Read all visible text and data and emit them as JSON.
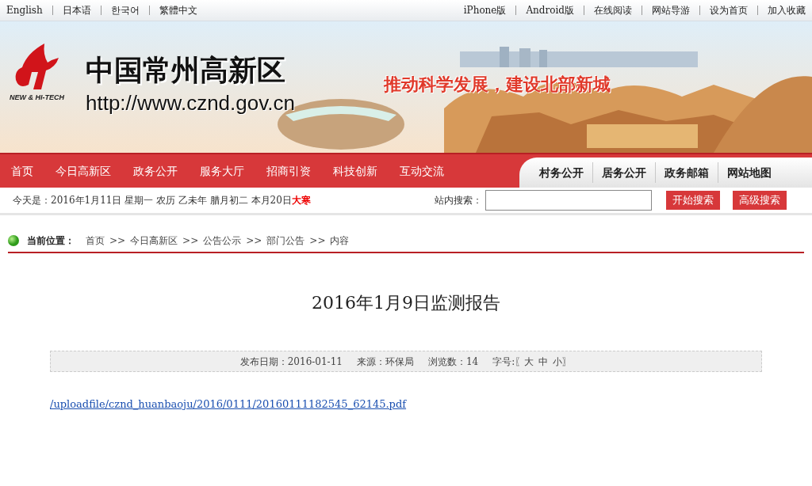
{
  "top_links_left": [
    "English",
    "日本语",
    "한국어",
    "繁體中文"
  ],
  "top_links_right": [
    "iPhone版",
    "Android版",
    "在线阅读",
    "网站导游",
    "设为首页",
    "加入收藏"
  ],
  "banner": {
    "kind": "picture",
    "logo_caption": "NEW & HI-TECH",
    "site_title": "中国常州高新区",
    "site_url": "http://www.cznd.gov.cn",
    "slogan": "推动科学发展，建设北部新城"
  },
  "nav_main": [
    "首页",
    "今日高新区",
    "政务公开",
    "服务大厅",
    "招商引资",
    "科技创新",
    "互动交流"
  ],
  "nav_secondary": [
    "村务公开",
    "居务公开",
    "政务邮箱",
    "网站地图"
  ],
  "date_line": {
    "text": "今天是：2016年1月11日  星期一  农历  乙未年  腊月初二  本月20日",
    "highlight": "大寒"
  },
  "search": {
    "label": "站内搜索：",
    "buttons": [
      "开始搜索",
      "高级搜索"
    ]
  },
  "breadcrumb": {
    "label": "当前位置：",
    "items": [
      "首页",
      "今日高新区",
      "公告公示",
      "部门公告",
      "内容"
    ],
    "separator": ">>"
  },
  "article": {
    "title": "2016年1月9日监测报告",
    "meta": [
      "发布日期：2016-01-11",
      "来源：环保局",
      "浏览数：14"
    ],
    "font_size": {
      "label": "字号:",
      "open": "〖",
      "sizes": [
        "大",
        "中",
        "小"
      ],
      "close": "〗"
    },
    "attachment": "/uploadfile/cznd_huanbaoju/2016/0111/20160111182545_62145.pdf"
  }
}
